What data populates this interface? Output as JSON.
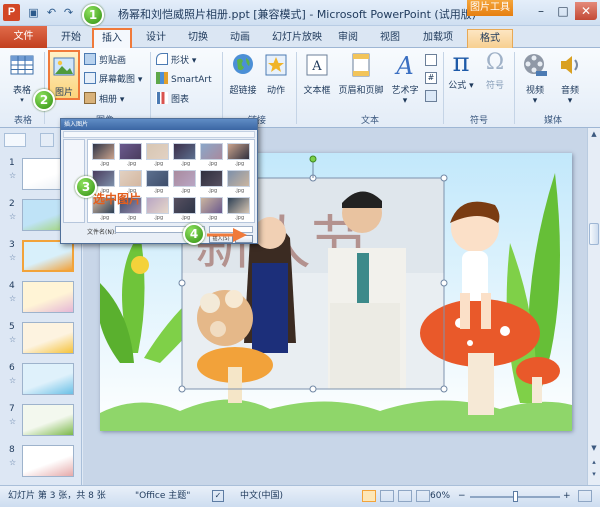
{
  "window": {
    "title": "杨幂和刘恺威照片相册.ppt [兼容模式] - Microsoft PowerPoint (试用版)",
    "context_tool": "图片工具",
    "app_logo": "P"
  },
  "tabs": [
    "文件",
    "开始",
    "插入",
    "设计",
    "切换",
    "动画",
    "幻灯片放映",
    "审阅",
    "视图",
    "加载项",
    "格式"
  ],
  "ribbon": {
    "groups": {
      "tables": "表格",
      "images": "图像",
      "links": "链接",
      "text": "文本",
      "symbols": "符号",
      "media": "媒体"
    },
    "buttons": {
      "table": "表格",
      "picture": "图片",
      "clipart": "剪贴画",
      "screenshot": "屏幕截图",
      "album": "相册",
      "shapes": "形状",
      "smartart": "SmartArt",
      "chart": "图表",
      "hyperlink": "超链接",
      "action": "动作",
      "textbox": "文本框",
      "header_footer": "页眉和页脚",
      "wordart": "艺术字",
      "formula": "公式",
      "symbol": "符号",
      "video": "视频",
      "audio": "音频"
    }
  },
  "badges": {
    "b1": "1",
    "b2": "2",
    "b3": "3",
    "b4": "4"
  },
  "callout_text": "选中图片",
  "slides": [
    "1",
    "2",
    "3",
    "4",
    "5",
    "6",
    "7",
    "8"
  ],
  "selected_slide": 3,
  "slide_text": {
    "chars": "新人节"
  },
  "dialog": {
    "title": "插入图片",
    "insert_button": "插入(S)",
    "filename_label": "文件名(N):",
    "caption": ".jpg"
  },
  "status": {
    "slide_info": "幻灯片 第 3 张，共 8 张",
    "theme": "\"Office 主题\"",
    "language": "中文(中国)",
    "zoom": "60%"
  },
  "colors": {
    "accent_orange": "#f07a3a",
    "file_tab": "#d24726",
    "badge_green": "#3aa317"
  }
}
